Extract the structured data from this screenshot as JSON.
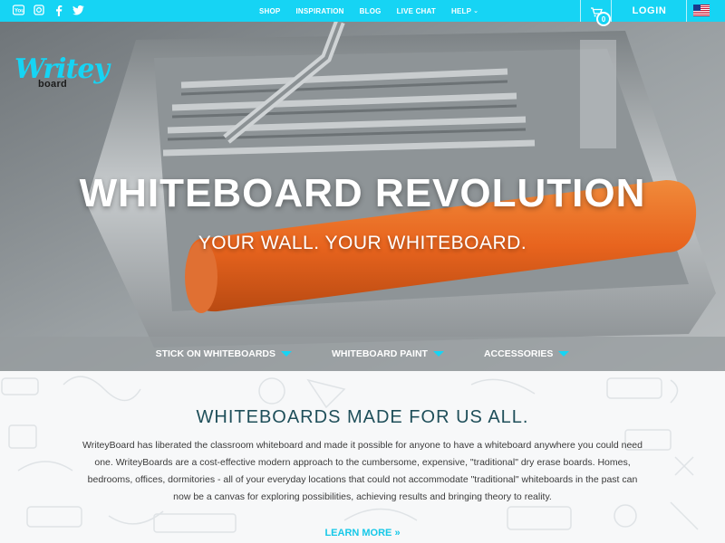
{
  "topbar": {
    "social": [
      "youtube-icon",
      "instagram-icon",
      "facebook-icon",
      "twitter-icon"
    ],
    "nav": [
      {
        "label": "SHOP"
      },
      {
        "label": "INSPIRATION"
      },
      {
        "label": "BLOG"
      },
      {
        "label": "LIVE CHAT"
      },
      {
        "label": "HELP"
      }
    ],
    "cart_count": "0",
    "login_label": "LOGIN",
    "flag": "us-flag-icon"
  },
  "hero": {
    "logo_text": "Writey",
    "logo_sub": "board",
    "title": "WHITEBOARD REVOLUTION",
    "subtitle": "YOUR WALL. YOUR WHITEBOARD.",
    "categories": [
      {
        "label": "STICK ON WHITEBOARDS"
      },
      {
        "label": "WHITEBOARD PAINT"
      },
      {
        "label": "ACCESSORIES"
      }
    ]
  },
  "content": {
    "title": "WHITEBOARDS MADE FOR US ALL.",
    "body": "WriteyBoard has liberated the classroom whiteboard and made it possible for anyone to have a whiteboard anywhere you could need one. WriteyBoards are a cost-effective modern approach to the cumbersome, expensive, \"traditional\" dry erase boards. Homes, bedrooms, offices, dormitories - all of your everyday locations that could not accommodate \"traditional\" whiteboards in the past can now be a canvas for exploring possibilities, achieving results and bringing theory to reality.",
    "learn_more": "LEARN MORE »"
  },
  "colors": {
    "accent": "#16d4f4",
    "heading": "#1f4f5a",
    "roller": "#e8641e"
  }
}
